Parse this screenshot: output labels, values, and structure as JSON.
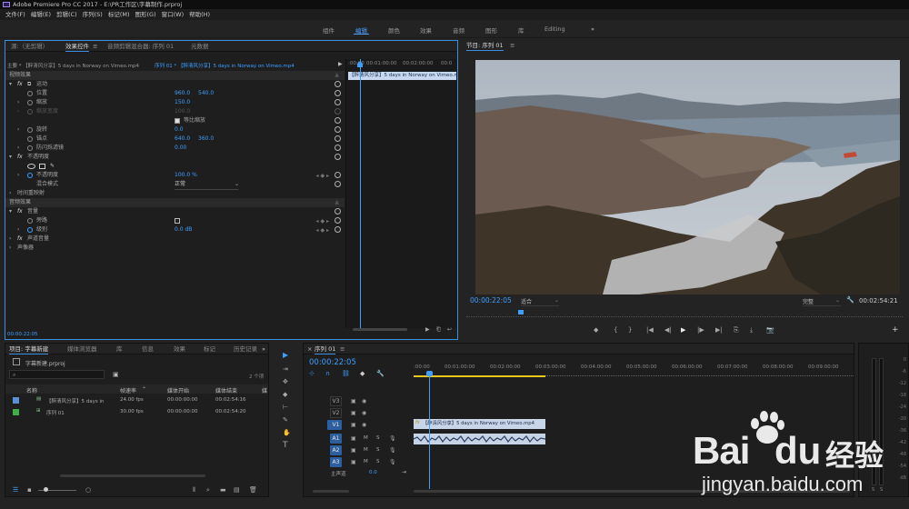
{
  "app": {
    "title": "Adobe Premiere Pro CC 2017 - E:\\PR工作区\\字幕制作.prproj"
  },
  "menu": [
    "文件(F)",
    "编辑(E)",
    "剪辑(C)",
    "序列(S)",
    "标记(M)",
    "图形(G)",
    "窗口(W)",
    "帮助(H)"
  ],
  "workspaces": [
    "组件",
    "编辑",
    "颜色",
    "效果",
    "音频",
    "图形",
    "库",
    "Editing"
  ],
  "workspace_more": "»",
  "effect_controls": {
    "tabs": [
      "源:（无剪辑）",
      "效果控件",
      "音频剪辑混合器: 序列 01",
      "元数据"
    ],
    "tab_menu": "≡",
    "clip_path": "主要 * 【醉清风分享】5 days in Norway on Vimeo.mp4",
    "seq_path": "序列 01 * 【醉清风分享】5 days in Norway on Vimeo.mp4",
    "play": "▶",
    "ruler": [
      ":00:00",
      "00:01:00:00",
      "00:02:00:00",
      "00:0"
    ],
    "clip_label": "【醉清风分享】5 days in Norway on Vimeo.mp4",
    "video_effects": "视频效果",
    "motion": "运动",
    "position": {
      "label": "位置",
      "x": "960.0",
      "y": "540.0"
    },
    "scale": {
      "label": "缩放",
      "value": "150.0"
    },
    "scale_width": {
      "label": "缩放宽度",
      "value": "100.0"
    },
    "uniform": "等比缩放",
    "rotation": {
      "label": "旋转",
      "value": "0.0"
    },
    "anchor": {
      "label": "锚点",
      "x": "640.0",
      "y": "360.0"
    },
    "antiflicker": {
      "label": "防闪烁滤镜",
      "value": "0.00"
    },
    "opacity_group": "不透明度",
    "opacity": {
      "label": "不透明度",
      "value": "100.0 %"
    },
    "blend": {
      "label": "混合模式",
      "value": "正常"
    },
    "time_remap": "时间重映射",
    "audio_effects": "音频效果",
    "volume_group": "音量",
    "bypass": {
      "label": "旁路"
    },
    "level": {
      "label": "级别",
      "value": "0.0 dB"
    },
    "channel_volume": "声道音量",
    "panner": "声像器",
    "timecode": "00:00:22:05"
  },
  "program": {
    "tab": "节目: 序列 01",
    "tab_menu": "≡",
    "timecode": "00:00:22:05",
    "fit": "适合",
    "quality": "完整",
    "duration": "00:02:54:21",
    "transport": [
      "◆",
      "{",
      "}",
      "|◀",
      "◀|",
      "▶",
      "|▶",
      "▶|",
      "⎘",
      "⤓",
      "📷"
    ],
    "add": "+"
  },
  "project": {
    "tabs": [
      "项目: 字幕新建",
      "媒体浏览器",
      "库",
      "信息",
      "效果",
      "标记",
      "历史记录"
    ],
    "more": "»",
    "file": "字幕新建.prproj",
    "count": "2 个项",
    "columns": [
      "名称",
      "帧速率",
      "媒体开始",
      "媒体结束",
      "媒"
    ],
    "rows": [
      {
        "name": "【醉清风分享】5 days in",
        "fps": "24.00 fps",
        "start": "00:00:00:00",
        "end": "00:02:54:16",
        "color": "#5b8fd6"
      },
      {
        "name": "序列 01",
        "fps": "30.00 fps",
        "start": "00:00:00:00",
        "end": "00:02:54:20",
        "color": "#3fae48"
      }
    ]
  },
  "tools": [
    "▶",
    "⇥",
    "✥",
    "◆",
    "⊢",
    "✎",
    "✋",
    "T"
  ],
  "timeline": {
    "tab": "序列 01",
    "tab_menu": "≡",
    "timecode": "00:00:22:05",
    "ruler": [
      ":00:00",
      "00:01:00:00",
      "00:02:00:00",
      "00:03:00:00",
      "00:04:00:00",
      "00:05:00:00",
      "00:06:00:00",
      "00:07:00:00",
      "00:08:00:00",
      "00:09:00:00"
    ],
    "video_tracks": [
      "V3",
      "V2",
      "V1"
    ],
    "audio_tracks": [
      "A1",
      "A2",
      "A3"
    ],
    "track_btn": [
      "M",
      "S"
    ],
    "master": {
      "label": "主声道",
      "value": "0.0"
    },
    "clip_label": "【醉清风分享】5 days in Norway on Vimeo.mp4",
    "clip_badge": "fx"
  },
  "meter": {
    "scale": [
      "0",
      "-6",
      "-12",
      "-18",
      "-24",
      "-30",
      "-36",
      "-42",
      "-48",
      "-54",
      "dB"
    ],
    "bottom": [
      "S",
      "S"
    ]
  },
  "watermark": {
    "text": "Bai",
    "logo": "du",
    "suffix": "经验",
    "url": "jingyan.baidu.com"
  },
  "colors": {
    "accent": "#3d9fff",
    "panel": "#1e1e1e",
    "sky_top": "#b3bcc6",
    "water": "#7d8e9e",
    "city": "#6d5a4e",
    "hill": "#3e3428",
    "yellow": "#e8c81a"
  }
}
